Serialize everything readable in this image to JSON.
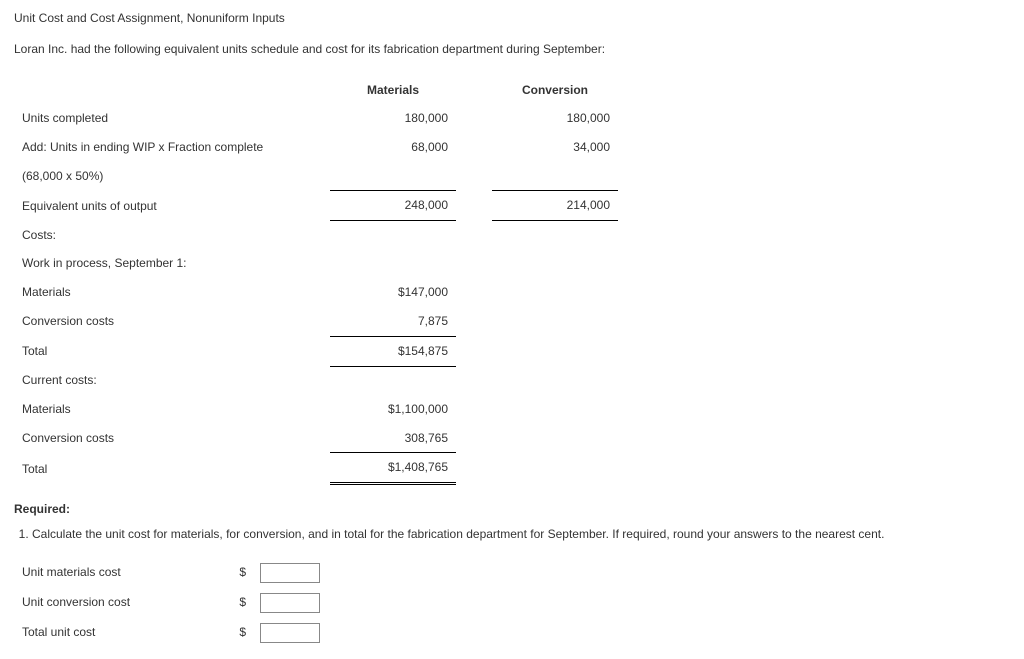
{
  "title": "Unit Cost and Cost Assignment, Nonuniform Inputs",
  "intro": "Loran Inc. had the following equivalent units schedule and cost for its fabrication department during September:",
  "sched": {
    "hdr_materials": "Materials",
    "hdr_conversion": "Conversion",
    "r1_label": "Units completed",
    "r1_mat": "180,000",
    "r1_conv": "180,000",
    "r2_label": "Add: Units in ending WIP x Fraction complete",
    "r2_mat": "68,000",
    "r2_conv": "34,000",
    "r3_label": "(68,000 x 50%)",
    "r4_label": "Equivalent units of output",
    "r4_mat": "248,000",
    "r4_conv": "214,000",
    "costs_label": "Costs:",
    "wip_label": "Work in process, September 1:",
    "wip_mat_label": "Materials",
    "wip_mat_val": "$147,000",
    "wip_conv_label": "Conversion costs",
    "wip_conv_val": "7,875",
    "wip_total_label": "Total",
    "wip_total_val": "$154,875",
    "cur_label": "Current costs:",
    "cur_mat_label": "Materials",
    "cur_mat_val": "$1,100,000",
    "cur_conv_label": "Conversion costs",
    "cur_conv_val": "308,765",
    "cur_total_label": "Total",
    "cur_total_val": "$1,408,765"
  },
  "required_label": "Required:",
  "req1": "Calculate the unit cost for materials, for conversion, and in total for the fabrication department for September. If required, round your answers to the nearest cent.",
  "inputs": {
    "mat_label": "Unit materials cost",
    "conv_label": "Unit conversion cost",
    "total_label": "Total unit cost",
    "dollar": "$"
  }
}
